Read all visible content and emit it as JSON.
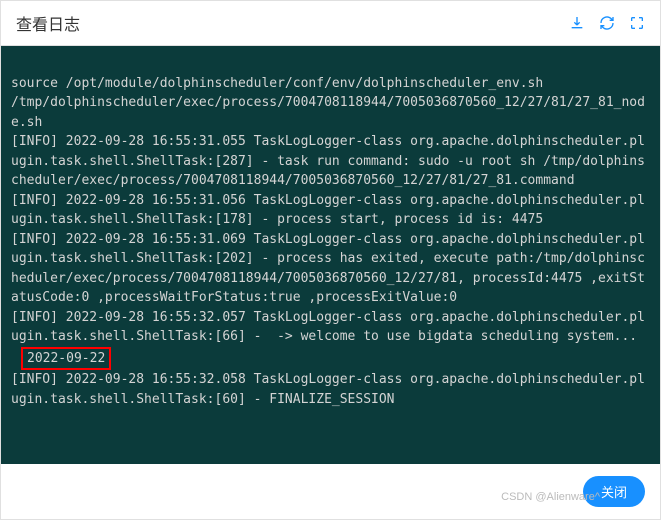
{
  "header": {
    "title": "查看日志",
    "icons": {
      "download": "download-icon",
      "refresh": "refresh-icon",
      "fullscreen": "fullscreen-icon"
    }
  },
  "log": {
    "lines": [
      "source /opt/module/dolphinscheduler/conf/env/dolphinscheduler_env.sh",
      "/tmp/dolphinscheduler/exec/process/7004708118944/7005036870560_12/27/81/27_81_node.sh",
      "[INFO] 2022-09-28 16:55:31.055 TaskLogLogger-class org.apache.dolphinscheduler.plugin.task.shell.ShellTask:[287] - task run command: sudo -u root sh /tmp/dolphinscheduler/exec/process/7004708118944/7005036870560_12/27/81/27_81.command",
      "[INFO] 2022-09-28 16:55:31.056 TaskLogLogger-class org.apache.dolphinscheduler.plugin.task.shell.ShellTask:[178] - process start, process id is: 4475",
      "[INFO] 2022-09-28 16:55:31.069 TaskLogLogger-class org.apache.dolphinscheduler.plugin.task.shell.ShellTask:[202] - process has exited, execute path:/tmp/dolphinscheduler/exec/process/7004708118944/7005036870560_12/27/81, processId:4475 ,exitStatusCode:0 ,processWaitForStatus:true ,processExitValue:0",
      "[INFO] 2022-09-28 16:55:32.057 TaskLogLogger-class org.apache.dolphinscheduler.plugin.task.shell.ShellTask:[66] -  -> welcome to use bigdata scheduling system..."
    ],
    "highlighted_date": "2022-09-22",
    "lines_after": [
      "[INFO] 2022-09-28 16:55:32.058 TaskLogLogger-class org.apache.dolphinscheduler.plugin.task.shell.ShellTask:[60] - FINALIZE_SESSION"
    ]
  },
  "footer": {
    "close_label": "关闭",
    "watermark": "CSDN @Alienware^"
  }
}
